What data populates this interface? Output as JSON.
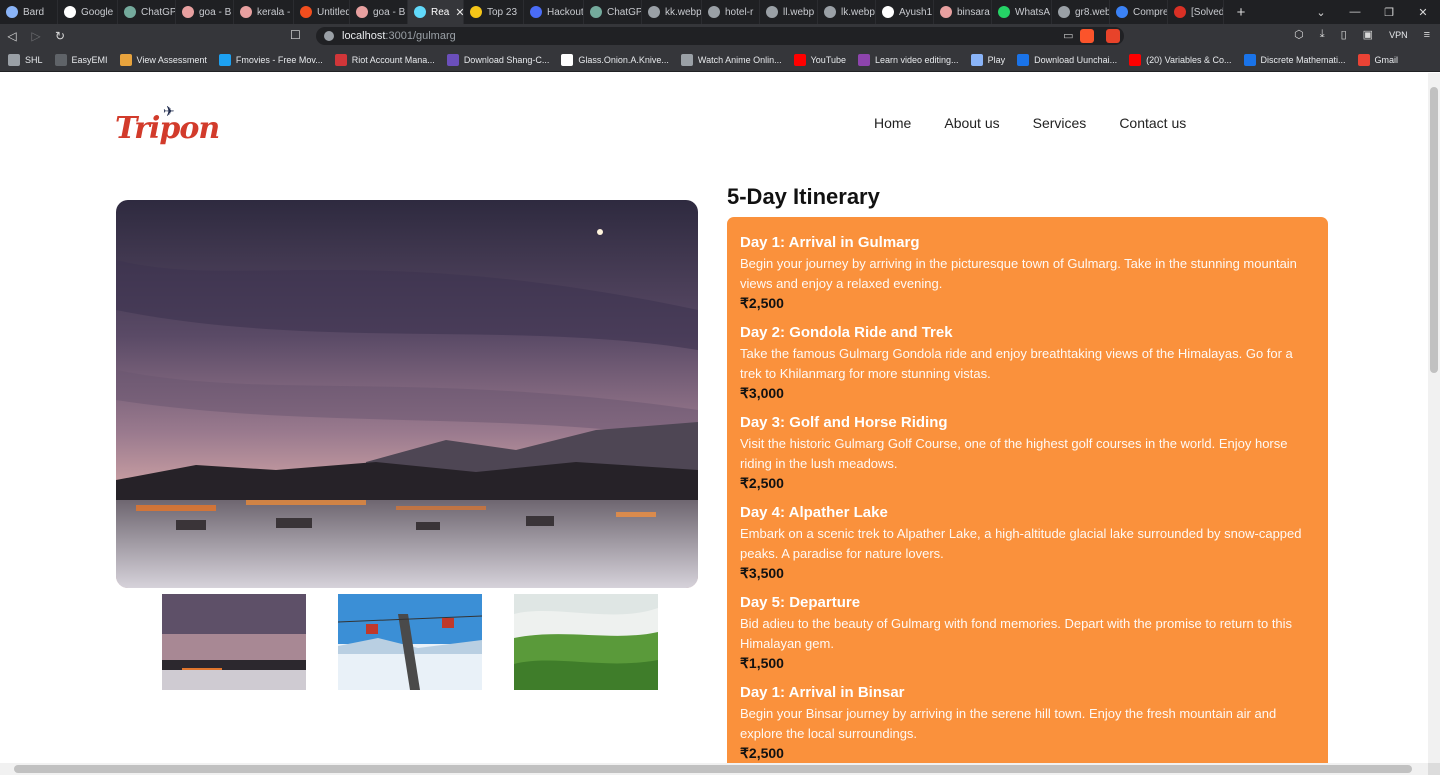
{
  "browser": {
    "tabs": [
      {
        "label": "Bard",
        "color": "#8ab4f8"
      },
      {
        "label": "Google",
        "color": "#ffffff"
      },
      {
        "label": "ChatGP",
        "color": "#74aa9c"
      },
      {
        "label": "goa - B",
        "color": "#e8a0a0"
      },
      {
        "label": "kerala -",
        "color": "#e8a0a0"
      },
      {
        "label": "Untitled",
        "color": "#f24e1e"
      },
      {
        "label": "goa - B",
        "color": "#e8a0a0"
      },
      {
        "label": "Rea",
        "color": "#61dafb"
      },
      {
        "label": "Top 23",
        "color": "#f5c518"
      },
      {
        "label": "Hackout",
        "color": "#4a6cf7"
      },
      {
        "label": "ChatGP",
        "color": "#74aa9c"
      },
      {
        "label": "kk.webp",
        "color": "#9aa0a6"
      },
      {
        "label": "hotel-r",
        "color": "#9aa0a6"
      },
      {
        "label": "ll.webp",
        "color": "#9aa0a6"
      },
      {
        "label": "lk.webp",
        "color": "#9aa0a6"
      },
      {
        "label": "Ayush1",
        "color": "#ffffff"
      },
      {
        "label": "binsara",
        "color": "#e8a0a0"
      },
      {
        "label": "WhatsA",
        "color": "#25d366"
      },
      {
        "label": "gr8.web",
        "color": "#9aa0a6"
      },
      {
        "label": "Compre",
        "color": "#3b82f6"
      },
      {
        "label": "[Solved]",
        "color": "#d93025"
      }
    ],
    "active_tab_index": 7,
    "new_tab_label": "+",
    "url_host": "localhost",
    "url_path": ":3001/gulmarg",
    "vpn_label": "VPN",
    "bookmarks": [
      {
        "label": "SHL",
        "color": "#9aa0a6"
      },
      {
        "label": "EasyEMI",
        "color": "#5f6368"
      },
      {
        "label": "View Assessment",
        "color": "#e8a33d"
      },
      {
        "label": "Fmovies - Free Mov...",
        "color": "#1da1f2"
      },
      {
        "label": "Riot Account Mana...",
        "color": "#d13639"
      },
      {
        "label": "Download Shang-C...",
        "color": "#6b4fbb"
      },
      {
        "label": "Glass.Onion.A.Knive...",
        "color": "#ffffff"
      },
      {
        "label": "Watch Anime Onlin...",
        "color": "#9aa0a6"
      },
      {
        "label": "YouTube",
        "color": "#ff0000"
      },
      {
        "label": "Learn video editing...",
        "color": "#8e44ad"
      },
      {
        "label": "Play",
        "color": "#8ab4f8"
      },
      {
        "label": "Download Uunchai...",
        "color": "#1a73e8"
      },
      {
        "label": "(20) Variables & Co...",
        "color": "#ff0000"
      },
      {
        "label": "Discrete Mathemati...",
        "color": "#1a73e8"
      },
      {
        "label": "Gmail",
        "color": "#ea4335"
      }
    ]
  },
  "site": {
    "logo": "Tripon",
    "nav": [
      "Home",
      "About us",
      "Services",
      "Contact us"
    ]
  },
  "itinerary": {
    "title": "5-Day Itinerary",
    "days": [
      {
        "title": "Day 1: Arrival in Gulmarg",
        "desc": "Begin your journey by arriving in the picturesque town of Gulmarg. Take in the stunning mountain views and enjoy a relaxed evening.",
        "price": "₹2,500"
      },
      {
        "title": "Day 2: Gondola Ride and Trek",
        "desc": "Take the famous Gulmarg Gondola ride and enjoy breathtaking views of the Himalayas. Go for a trek to Khilanmarg for more stunning vistas.",
        "price": "₹3,000"
      },
      {
        "title": "Day 3: Golf and Horse Riding",
        "desc": "Visit the historic Gulmarg Golf Course, one of the highest golf courses in the world. Enjoy horse riding in the lush meadows.",
        "price": "₹2,500"
      },
      {
        "title": "Day 4: Alpather Lake",
        "desc": "Embark on a scenic trek to Alpather Lake, a high-altitude glacial lake surrounded by snow-capped peaks. A paradise for nature lovers.",
        "price": "₹3,500"
      },
      {
        "title": "Day 5: Departure",
        "desc": "Bid adieu to the beauty of Gulmarg with fond memories. Depart with the promise to return to this Himalayan gem.",
        "price": "₹1,500"
      },
      {
        "title": "Day 1: Arrival in Binsar",
        "desc": "Begin your Binsar journey by arriving in the serene hill town. Enjoy the fresh mountain air and explore the local surroundings.",
        "price": "₹2,500"
      }
    ]
  },
  "colors": {
    "itinerary_bg": "#fa913c",
    "logo_red": "#d23b2b"
  }
}
